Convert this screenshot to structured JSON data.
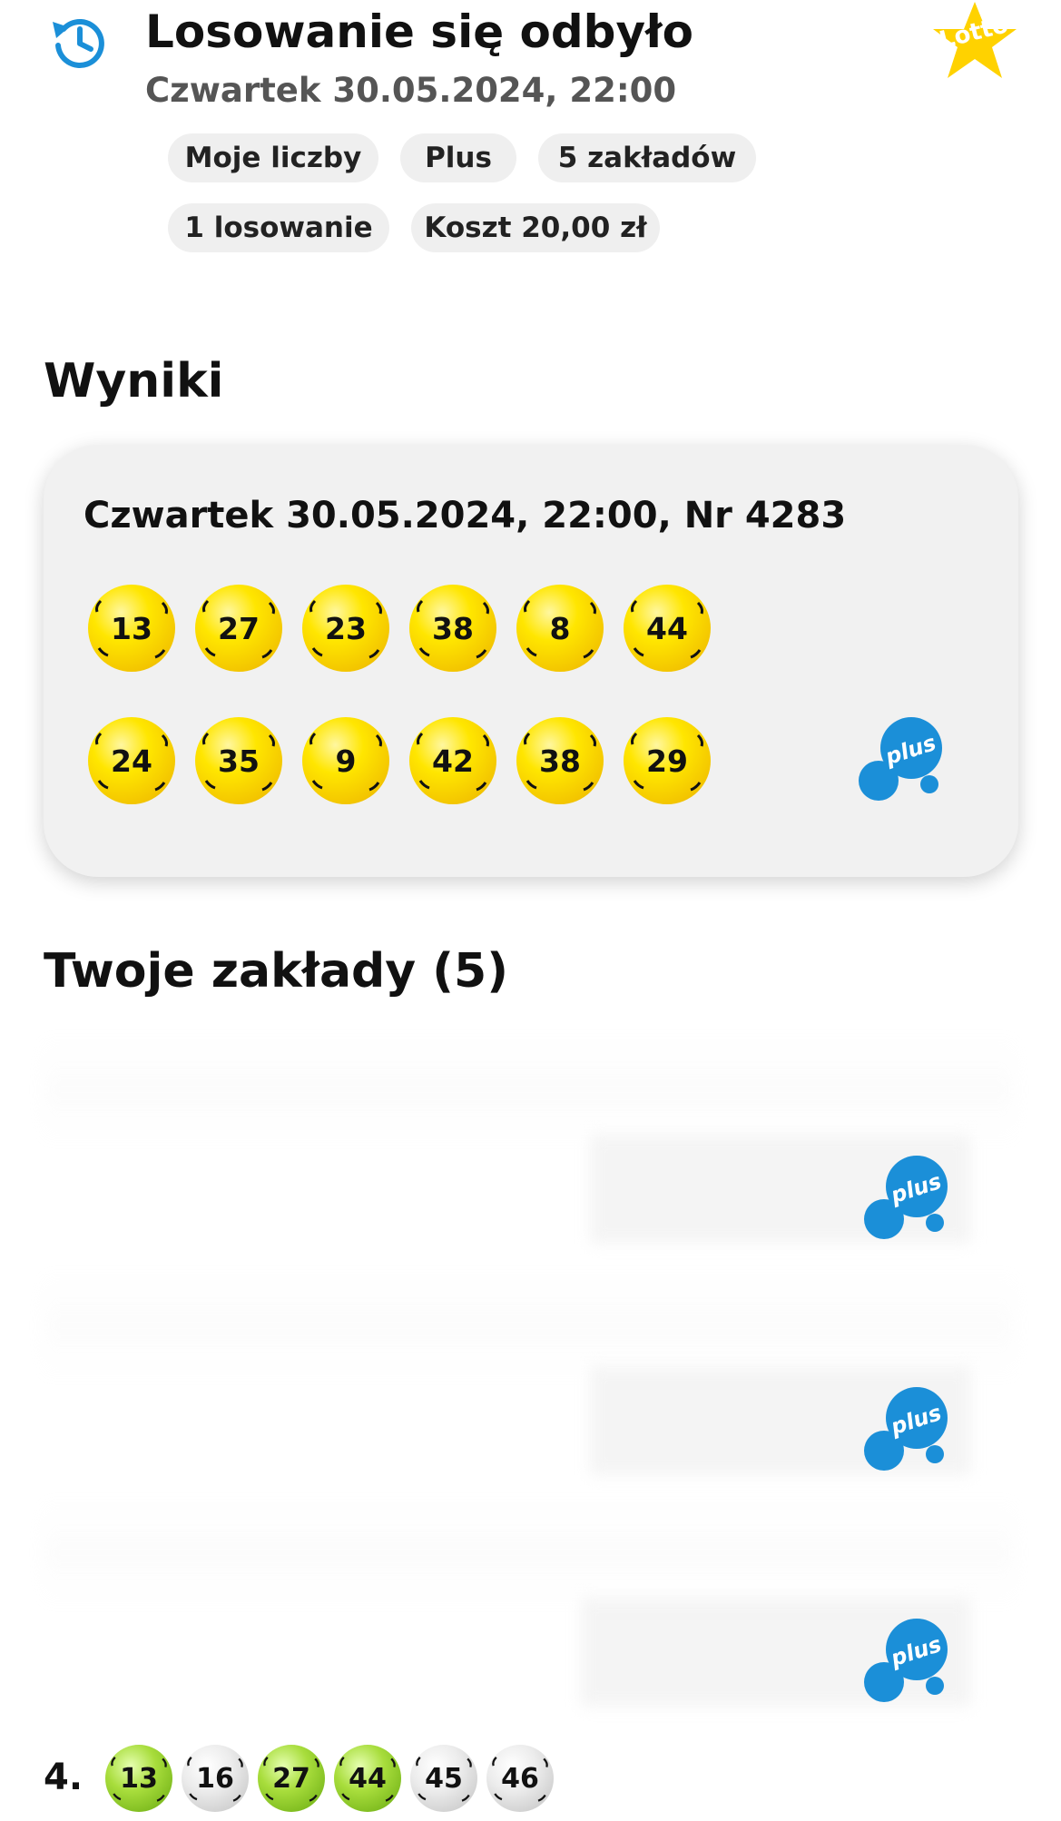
{
  "header": {
    "title": "Losowanie się odbyło",
    "subtitle": "Czwartek 30.05.2024, 22:00",
    "history_icon": "history-clock-icon",
    "logo_text": "Lotto"
  },
  "chips": {
    "row1": [
      "Moje liczby",
      "Plus",
      "5 zakładów"
    ],
    "row2": [
      "1 losowanie",
      "Koszt 20,00 zł"
    ]
  },
  "results": {
    "heading": "Wyniki",
    "draw_info": "Czwartek 30.05.2024, 22:00, Nr 4283",
    "lotto_numbers": [
      "13",
      "27",
      "23",
      "38",
      "8",
      "44"
    ],
    "plus_numbers": [
      "24",
      "35",
      "9",
      "42",
      "38",
      "29"
    ],
    "plus_logo_text": "plus"
  },
  "bets": {
    "heading": "Twoje zakłady (5)",
    "plus_logo_text": "plus",
    "visible_bet": {
      "index": "4.",
      "numbers": [
        "13",
        "16",
        "27",
        "44",
        "45",
        "46"
      ],
      "states": [
        "hit",
        "miss",
        "hit",
        "hit",
        "miss",
        "miss"
      ]
    }
  },
  "colors": {
    "accent_blue": "#1b8fd8",
    "ball_yellow": "#ffe600",
    "ball_green": "#8cc63f",
    "ball_silver": "#d9d9d9",
    "chip_bg": "#efefef",
    "lotto_star": "#ffd200"
  }
}
